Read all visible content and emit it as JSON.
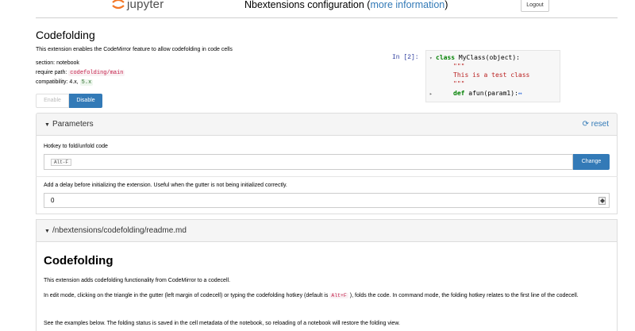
{
  "header": {
    "logo_text": "jupyter",
    "title_prefix": "Nbextensions configuration (",
    "title_link": "more information",
    "title_suffix": ")",
    "logout_label": "Logout"
  },
  "extension": {
    "name": "Codefolding",
    "description": "This extension enables the CodeMirror feature to allow codefolding in code cells",
    "section_label": "section:",
    "section_value": "notebook",
    "require_label": "require path:",
    "require_value": "codefolding/main",
    "compat_label": "compatibility:",
    "compat_value": "4.x,",
    "compat_value2": "5.x",
    "enable_label": "Enable",
    "disable_label": "Disable"
  },
  "code_preview": {
    "prompt": "In [2]:",
    "lines": [
      {
        "kw": "class",
        "text": " MyClass(object):"
      },
      {
        "text": "\"\"\""
      },
      {
        "text": "This is a test class"
      },
      {
        "text": "\"\"\""
      },
      {
        "kw": "def",
        "text": " afun(param1):",
        "fold": "↔"
      }
    ]
  },
  "parameters": {
    "title": "Parameters",
    "reset_label": "reset",
    "hotkey_label": "Hotkey to fold/unfold code",
    "hotkey_value": "Alt-F",
    "change_label": "Change",
    "delay_label": "Add a delay before initializing the extension. Useful when the gutter is not being initialized correctly.",
    "delay_value": "0"
  },
  "readme": {
    "path": "/nbextensions/codefolding/readme.md",
    "title": "Codefolding",
    "p1": "This extension adds codefolding functionality from CodeMirror to a codecell.",
    "p2_a": "In edit mode, clicking on the triangle in the gutter (left margin of codecell) or typing the codefolding hotkey (default is ",
    "p2_code": "Alt+F",
    "p2_b": " ), folds the code. In command mode, the folding hotkey relates to the first line of the codecell.",
    "p3": "See the examples below. The folding status is saved in the cell metadata of the notebook, so reloading of a notebook will restore the folding view."
  },
  "colors": {
    "accent": "#337ab7",
    "jupyter_orange": "#f37726"
  }
}
